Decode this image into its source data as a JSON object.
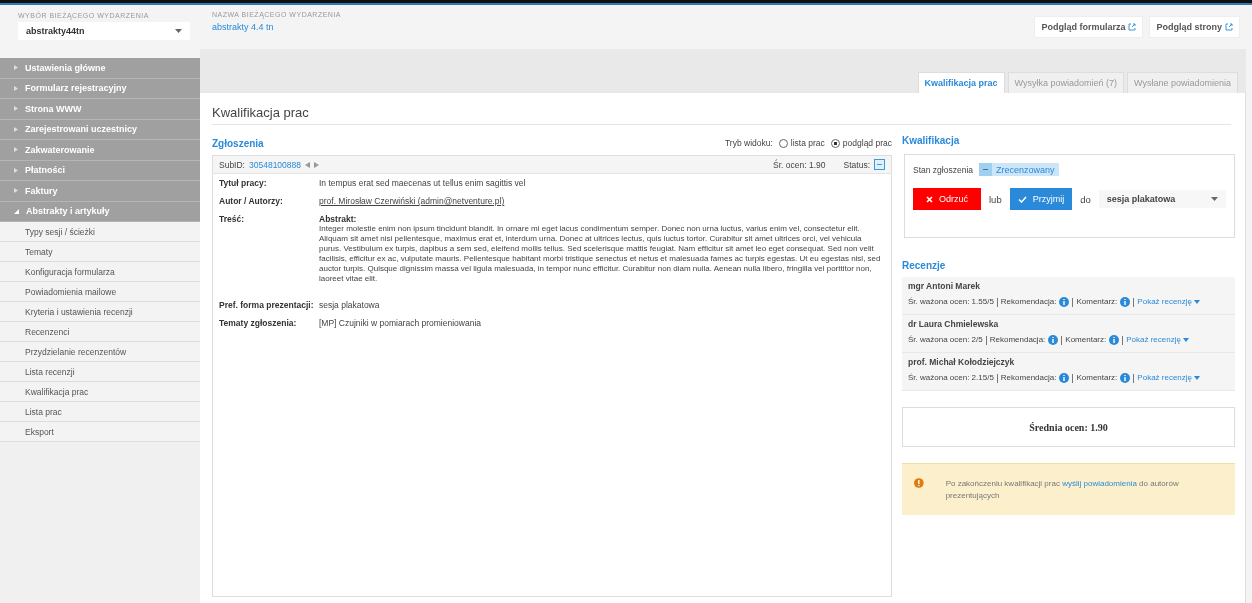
{
  "event_selector": {
    "label": "WYBÓR BIEŻĄCEGO WYDARZENIA",
    "value": "abstrakty44tn"
  },
  "event_name": {
    "label": "NAZWA BIEŻĄCEGO WYDARZENIA",
    "value": "abstrakty 4.4 tn"
  },
  "header_buttons": [
    "Podgląd formularza",
    "Podgląd strony"
  ],
  "sidebar": {
    "items": [
      {
        "label": "Ustawienia główne",
        "expanded": false
      },
      {
        "label": "Formularz rejestracyjny",
        "expanded": false
      },
      {
        "label": "Strona WWW",
        "expanded": false
      },
      {
        "label": "Zarejestrowani uczestnicy",
        "expanded": false
      },
      {
        "label": "Zakwaterowanie",
        "expanded": false
      },
      {
        "label": "Płatności",
        "expanded": false
      },
      {
        "label": "Faktury",
        "expanded": false
      },
      {
        "label": "Abstrakty i artykuły",
        "expanded": true,
        "children": [
          {
            "label": "Typy sesji / ścieżki"
          },
          {
            "label": "Tematy"
          },
          {
            "label": "Konfiguracja formularza"
          },
          {
            "label": "Powiadomienia mailowe"
          },
          {
            "label": "Kryteria i ustawienia recenzji"
          },
          {
            "label": "Recenzenci"
          },
          {
            "label": "Przydzielanie recenzentów"
          },
          {
            "label": "Lista recenzji"
          },
          {
            "label": "Kwalifikacja prac"
          },
          {
            "label": "Lista prac"
          },
          {
            "label": "Eksport"
          }
        ]
      }
    ]
  },
  "tabs": [
    {
      "label": "Kwalifikacja prac",
      "selected": true
    },
    {
      "label": "Wysyłka powiadomień (7)",
      "selected": false
    },
    {
      "label": "Wysłane powiadomienia",
      "selected": false
    }
  ],
  "page_title": "Kwalifikacja prac",
  "submissions": {
    "heading": "Zgłoszenia",
    "view_mode_label": "Tryb widoku:",
    "view_modes": [
      {
        "label": "lista prac",
        "selected": false
      },
      {
        "label": "podgląd prac",
        "selected": true
      }
    ],
    "subid_label": "SubID:",
    "subid": "30548100888",
    "score": "Śr. ocen: 1.90",
    "status_label": "Status:",
    "fields": [
      {
        "kind": "text",
        "label": "Tytuł pracy:",
        "value": "In tempus erat sed maecenas ut tellus enim sagittis vel"
      },
      {
        "kind": "link",
        "label": "Autor / Autorzy:",
        "value": "prof. Mirosław Czerwiński (admin@netventure.pl)"
      },
      {
        "kind": "abstract",
        "label": "Treść:",
        "heading": "Abstrakt:",
        "value": "Integer molestie enim non ipsum tincidunt blandit. In ornare mi eget lacus condimentum semper. Donec non urna luctus, varius enim vel, consectetur elit. Aliquam sit amet nisi pellentesque, maximus erat et, interdum urna. Donec at ultrices lectus, quis luctus tortor. Curabitur sit amet ultrices orci, vel vehicula purus. Vestibulum ex turpis, dapibus a sem sed, eleifend mollis tellus. Sed scelerisque mattis feugiat. Nam efficitur sit amet leo eget consequat. Sed non velit facilisis, efficitur ex ac, vulputate mauris. Pellentesque habitant morbi tristique senectus et netus et malesuada fames ac turpis egestas. Ut eu egestas nisl, sed auctor turpis. Quisque dignissim massa vel ligula malesuada, in tempor nunc efficitur. Curabitur non diam nulla. Aenean nulla libero, fringilla vel porttitor non, laoreet vitae elit."
      },
      {
        "kind": "text",
        "label": "Pref. forma prezentacji:",
        "value": "sesja plakatowa"
      },
      {
        "kind": "text",
        "label": "Tematy zgłoszenia:",
        "value": "[MP] Czujniki w pomiarach promieniowania"
      }
    ]
  },
  "qualification": {
    "heading": "Kwalifikacja",
    "state_label": "Stan zgłoszenia",
    "state": "Zrecenzowany",
    "reject": "Odrzuć",
    "or": "lub",
    "accept": "Przyjmij",
    "to": "do",
    "session": "sesja plakatowa"
  },
  "reviews": {
    "heading": "Recenzje",
    "items": [
      {
        "name": "mgr Antoni Marek",
        "score": "Śr. ważona ocen: 1.55/5",
        "recommendation": "Rekomendacja:",
        "comment": "Komentarz:",
        "link": "Pokaż recenzję"
      },
      {
        "name": "dr Laura Chmielewska",
        "score": "Śr. ważona ocen: 2/5",
        "recommendation": "Rekomendacja:",
        "comment": "Komentarz:",
        "link": "Pokaż recenzję"
      },
      {
        "name": "prof. Michał Kołodziejczyk",
        "score": "Śr. ważona ocen: 2.15/5",
        "recommendation": "Rekomendacja:",
        "comment": "Komentarz:",
        "link": "Pokaż recenzję"
      }
    ]
  },
  "average": "Średnia ocen: 1.90",
  "notice": {
    "before": "Po zakończeniu kwalifikacji prac",
    "link": "wyślij powiadomienia",
    "after": "do autorów prezentujących"
  }
}
